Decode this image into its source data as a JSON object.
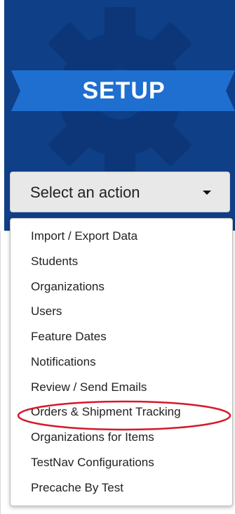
{
  "setup_panel": {
    "title": "SETUP",
    "icon": "gear-icon",
    "colors": {
      "panel_blue": "#0f3f86",
      "ribbon_blue": "#1e6fd0",
      "gear_dark": "#0c3678"
    }
  },
  "action_select": {
    "label": "Select an action",
    "icon": "caret-down-icon"
  },
  "dropdown": {
    "items": [
      {
        "label": "Import / Export Data"
      },
      {
        "label": "Students"
      },
      {
        "label": "Organizations"
      },
      {
        "label": "Users"
      },
      {
        "label": "Feature Dates"
      },
      {
        "label": "Notifications"
      },
      {
        "label": "Review / Send Emails"
      },
      {
        "label": "Orders & Shipment Tracking"
      },
      {
        "label": "Organizations for Items"
      },
      {
        "label": "TestNav Configurations"
      },
      {
        "label": "Precache By Test"
      }
    ],
    "highlighted_item": "Orders & Shipment Tracking",
    "highlight_color": "#d7182a"
  }
}
